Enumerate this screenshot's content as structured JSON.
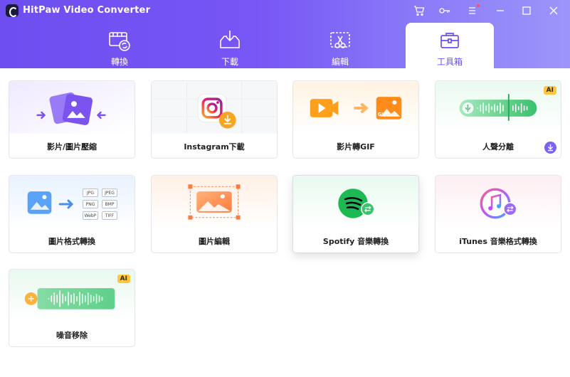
{
  "window": {
    "title": "HitPaw Video Converter"
  },
  "nav": {
    "tabs": [
      {
        "label": "轉換"
      },
      {
        "label": "下載"
      },
      {
        "label": "編輯"
      },
      {
        "label": "工具箱"
      }
    ],
    "active_tab": "工具箱"
  },
  "tools": [
    {
      "label": "影片/圖片壓縮"
    },
    {
      "label": "Instagram下載"
    },
    {
      "label": "影片轉GIF"
    },
    {
      "label": "人聲分離",
      "badge": "AI"
    },
    {
      "label": "圖片格式轉換",
      "formats": [
        "JPG",
        "JPEG",
        "PNG",
        "BMP",
        "WebP",
        "TIFF"
      ]
    },
    {
      "label": "圖片編輯"
    },
    {
      "label": "Spotify 音樂轉換"
    },
    {
      "label": "iTunes 音樂格式轉換"
    },
    {
      "label": "噪音移除",
      "badge": "AI"
    }
  ],
  "gif_label": "GIF",
  "colors": {
    "accent": "#6b4ff0",
    "ai_badge": "#ffc53d",
    "spotify": "#1db954"
  }
}
